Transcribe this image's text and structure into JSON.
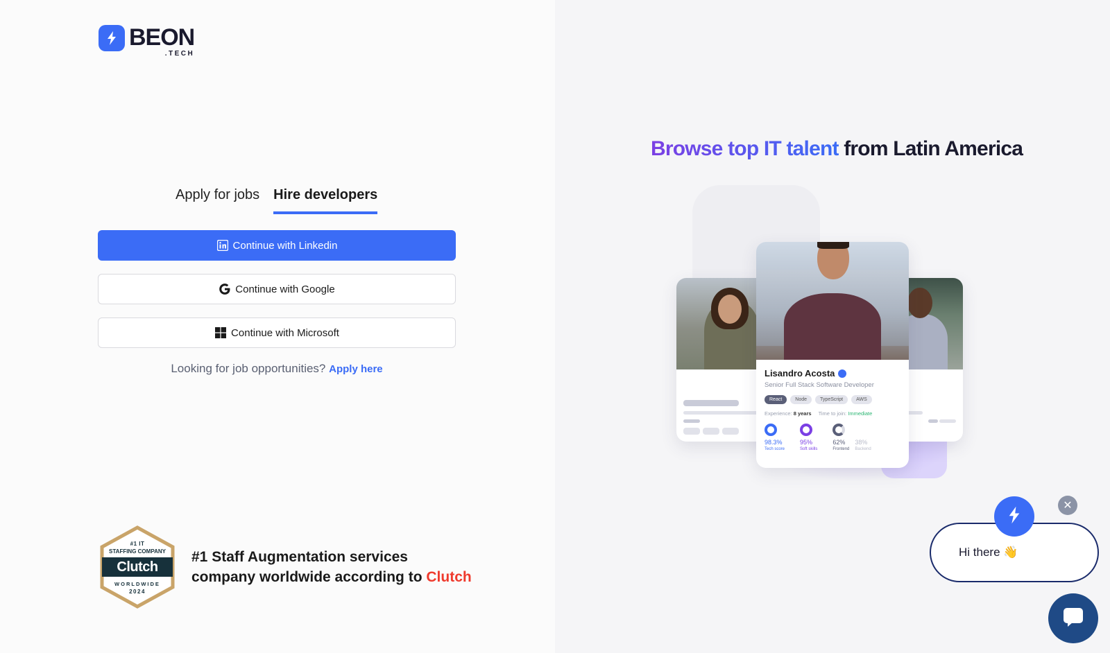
{
  "brand": {
    "name": "BEON",
    "suffix": ".TECH"
  },
  "tabs": [
    {
      "label": "Apply for jobs",
      "active": false
    },
    {
      "label": "Hire developers",
      "active": true
    }
  ],
  "auth": {
    "linkedin_label": "Continue with Linkedin",
    "google_label": "Continue with Google",
    "microsoft_label": "Continue with Microsoft"
  },
  "apply": {
    "prompt": "Looking for job opportunities?",
    "link": "Apply here"
  },
  "clutch": {
    "badge_top": "#1 IT",
    "badge_mid": "STAFFING COMPANY",
    "badge_logo": "Clutch",
    "badge_bottom": "WORLDWIDE",
    "badge_year": "2024",
    "line1": "#1 Staff Augmentation services",
    "line2_prefix": "company worldwide according to",
    "line2_brand": "Clutch"
  },
  "hero": {
    "highlight": "Browse top IT talent",
    "rest": "from Latin America"
  },
  "profile": {
    "name": "Lisandro Acosta",
    "role": "Senior Full Stack Software Developer",
    "skills": [
      "React",
      "Node",
      "TypeScript",
      "AWS"
    ],
    "experience_label": "Experience:",
    "experience_value": "8 years",
    "join_label": "Time to join:",
    "join_value": "Immediate",
    "scores": [
      {
        "value": "98.3%",
        "label": "Tech score"
      },
      {
        "value": "95%",
        "label": "Soft skills"
      },
      {
        "value": "62%",
        "label": "Frontend"
      },
      {
        "value": "38%",
        "label": "Backend"
      }
    ]
  },
  "chat": {
    "greeting": "Hi there 👋",
    "close": "✕"
  },
  "colors": {
    "accent": "#3b6cf6",
    "purple": "#7b3fe4",
    "clutch_red": "#ef3a2d",
    "chat_navy": "#1f4a86"
  },
  "icons": [
    "bolt-icon",
    "linkedin-icon",
    "google-icon",
    "microsoft-icon",
    "verified-icon",
    "close-icon",
    "chat-icon"
  ]
}
